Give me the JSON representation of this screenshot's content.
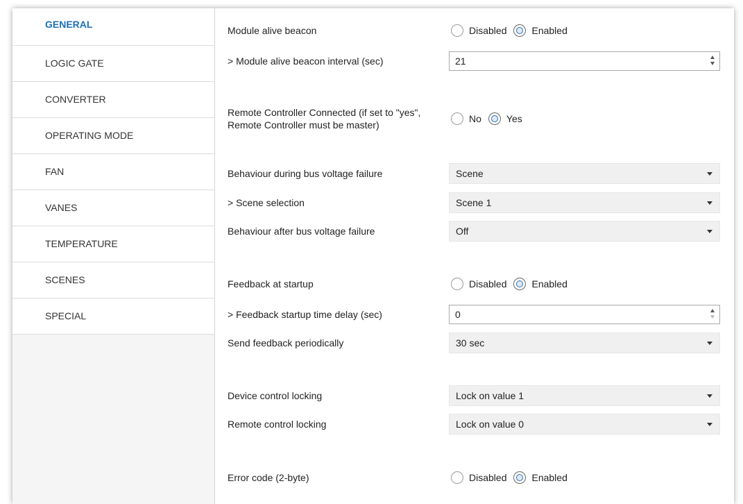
{
  "sidebar": {
    "items": [
      {
        "label": "GENERAL",
        "active": true
      },
      {
        "label": "LOGIC GATE"
      },
      {
        "label": "CONVERTER"
      },
      {
        "label": "OPERATING MODE"
      },
      {
        "label": "FAN"
      },
      {
        "label": "VANES"
      },
      {
        "label": "TEMPERATURE"
      },
      {
        "label": "SCENES"
      },
      {
        "label": "SPECIAL"
      }
    ]
  },
  "params": {
    "alive_beacon": {
      "label": "Module alive beacon",
      "opt1": "Disabled",
      "opt2": "Enabled",
      "selected": "Enabled"
    },
    "alive_interval": {
      "label": "> Module alive beacon interval (sec)",
      "value": "21"
    },
    "remote_connected": {
      "label": "Remote Controller Connected (if set to \"yes\", Remote Controller must be master)",
      "opt1": "No",
      "opt2": "Yes",
      "selected": "Yes"
    },
    "bus_failure": {
      "label": "Behaviour during bus voltage failure",
      "value": "Scene"
    },
    "scene_selection": {
      "label": "> Scene selection",
      "value": "Scene 1"
    },
    "after_bus_failure": {
      "label": "Behaviour after bus voltage failure",
      "value": "Off"
    },
    "feedback_startup": {
      "label": "Feedback at startup",
      "opt1": "Disabled",
      "opt2": "Enabled",
      "selected": "Enabled"
    },
    "feedback_delay": {
      "label": "> Feedback startup time delay (sec)",
      "value": "0"
    },
    "send_feedback": {
      "label": "Send feedback periodically",
      "value": "30 sec"
    },
    "device_locking": {
      "label": "Device control locking",
      "value": "Lock on value 1"
    },
    "remote_locking": {
      "label": "Remote control locking",
      "value": "Lock on value 0"
    },
    "error_code": {
      "label": "Error code (2-byte)",
      "opt1": "Disabled",
      "opt2": "Enabled",
      "selected": "Enabled"
    }
  },
  "colors": {
    "accent": "#1c6fb8",
    "select_bg": "#f0f0f0",
    "sidebar_bg": "#f5f5f5"
  }
}
